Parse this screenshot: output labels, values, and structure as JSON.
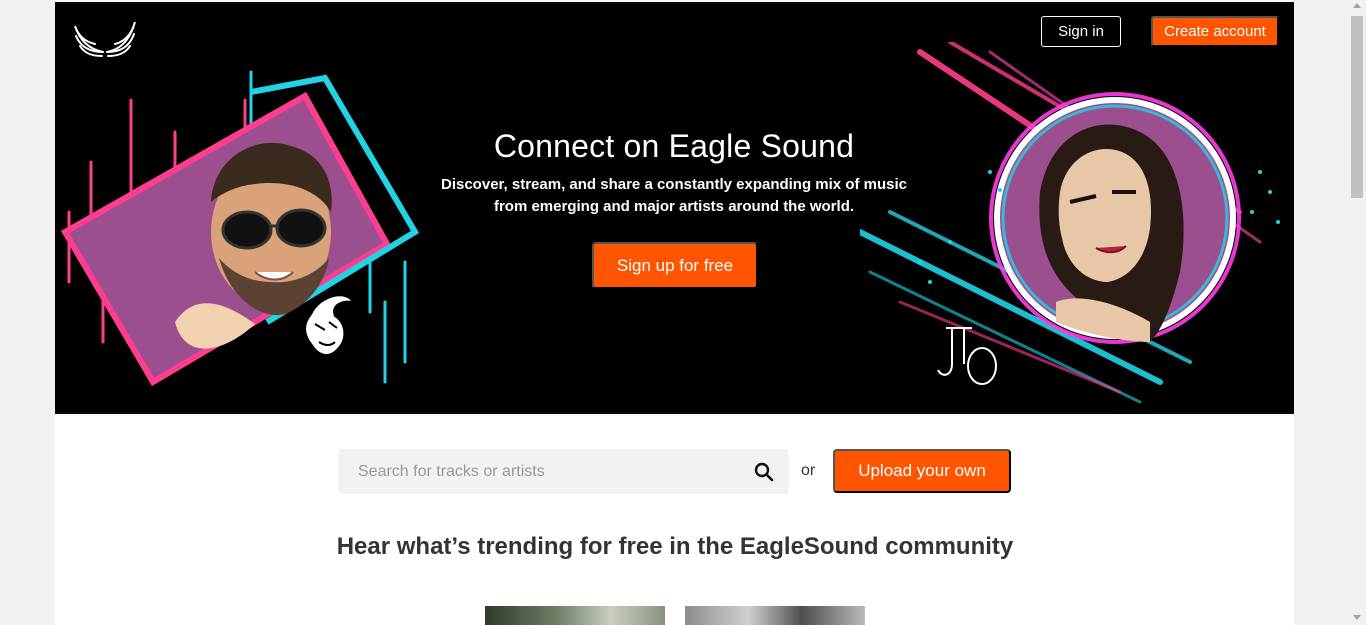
{
  "header": {
    "logo_icon": "eagle-wings-icon",
    "signin_label": "Sign in",
    "create_account_label": "Create account"
  },
  "hero": {
    "title": "Connect on Eagle Sound",
    "subtitle_line1": "Discover, stream, and share a constantly expanding mix of music",
    "subtitle_line2": "from emerging and major artists around the world.",
    "signup_label": "Sign up for free",
    "left_art_signature": "mask-signature-logo",
    "right_art_signature": "JO"
  },
  "search": {
    "placeholder": "Search for tracks or artists",
    "value": "",
    "icon": "search-icon"
  },
  "or_text": "or",
  "upload_label": "Upload your own",
  "trending_title": "Hear what’s trending for free in the EagleSound community",
  "colors": {
    "accent": "#ff5500",
    "hero_bg": "#000000",
    "page_bg": "#f2f2f2",
    "neon_pink": "#ff3d8f",
    "neon_cyan": "#22d3e6",
    "purple": "#9b4f8e"
  }
}
